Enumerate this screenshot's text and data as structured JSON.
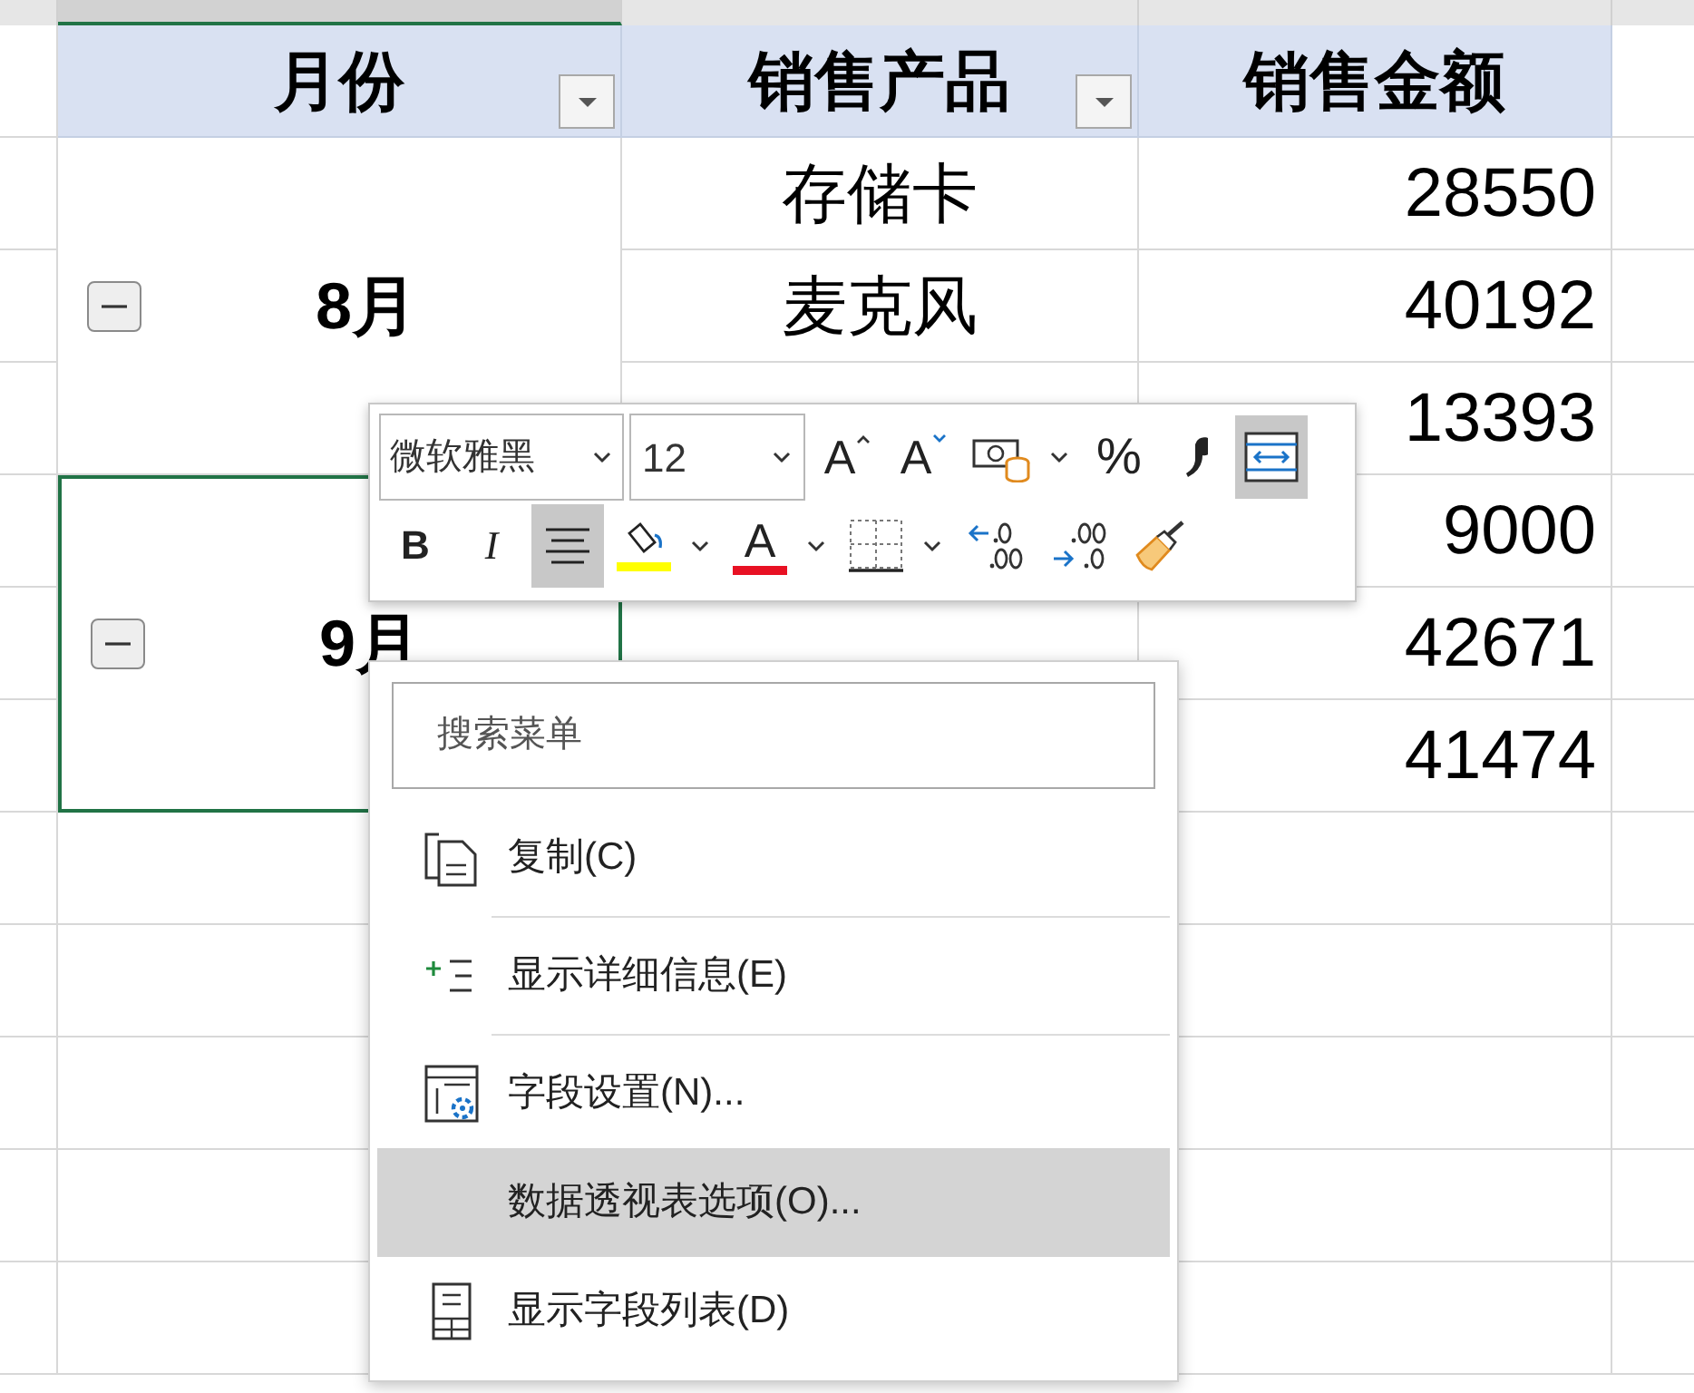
{
  "column_headers": [
    {
      "selected": true
    },
    {
      "selected": false
    },
    {
      "selected": false
    }
  ],
  "table": {
    "columns": [
      {
        "label": "月份",
        "filter": true
      },
      {
        "label": "销售产品",
        "filter": true
      },
      {
        "label": "销售金额",
        "filter": false
      }
    ],
    "groups": [
      {
        "month": "8月",
        "expanded": true,
        "selected": false,
        "rows": [
          {
            "product": "存储卡",
            "amount": "28550"
          },
          {
            "product": "麦克风",
            "amount": "40192"
          },
          {
            "amount": "13393"
          }
        ]
      },
      {
        "month": "9月",
        "expanded": true,
        "selected": true,
        "rows": [
          {
            "amount": "9000"
          },
          {
            "amount": "42671"
          },
          {
            "amount": "41474"
          }
        ]
      }
    ]
  },
  "mini_toolbar": {
    "font": "微软雅黑",
    "size": "12",
    "row_1": [
      {
        "kind": "grow-font",
        "label": "A",
        "selected": false,
        "dropdown": false
      },
      {
        "kind": "shrink-font",
        "label": "A",
        "selected": false,
        "dropdown": false
      },
      {
        "kind": "accounting",
        "selected": false,
        "dropdown": true
      },
      {
        "kind": "percent",
        "label": "%",
        "selected": false,
        "dropdown": false
      },
      {
        "kind": "comma",
        "selected": false,
        "dropdown": false
      },
      {
        "kind": "wrap",
        "selected": true,
        "dropdown": false
      }
    ],
    "row_2": [
      {
        "kind": "bold",
        "label": "B",
        "selected": false,
        "dropdown": false
      },
      {
        "kind": "italic",
        "label": "I",
        "selected": false,
        "dropdown": false
      },
      {
        "kind": "align-center",
        "selected": true,
        "dropdown": false
      },
      {
        "kind": "fill-color",
        "color": "#ffff00",
        "selected": false,
        "dropdown": true
      },
      {
        "kind": "font-color",
        "label": "A",
        "color": "#e81123",
        "selected": false,
        "dropdown": true
      },
      {
        "kind": "borders",
        "selected": false,
        "dropdown": true
      },
      {
        "kind": "increase-decimal",
        "selected": false,
        "dropdown": false
      },
      {
        "kind": "decrease-decimal",
        "selected": false,
        "dropdown": false
      },
      {
        "kind": "format-painter",
        "selected": false,
        "dropdown": false
      }
    ]
  },
  "context_menu": {
    "search": {
      "placeholder": "搜索菜单"
    },
    "items": [
      {
        "kind": "copy",
        "label": "复制(C)",
        "selected": false,
        "separator_after": true
      },
      {
        "kind": "show-details",
        "label": "显示详细信息(E)",
        "selected": false,
        "separator_after": true
      },
      {
        "kind": "field-settings",
        "label": "字段设置(N)...",
        "selected": false,
        "separator_after": false
      },
      {
        "kind": "none",
        "label": "数据透视表选项(O)...",
        "selected": true,
        "separator_after": false
      },
      {
        "kind": "field-list",
        "label": "显示字段列表(D)",
        "selected": false,
        "separator_after": false
      }
    ]
  }
}
